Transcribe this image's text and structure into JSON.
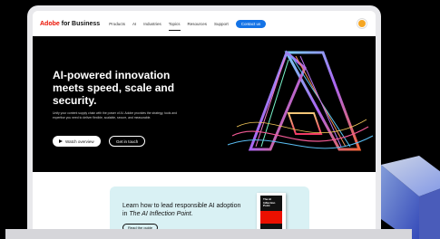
{
  "nav": {
    "brand_adobe": "Adobe",
    "brand_text": "for Business",
    "links": [
      "Products",
      "AI",
      "Industries",
      "Topics",
      "Resources",
      "Support"
    ],
    "active_index": 3,
    "contact_label": "Contact us"
  },
  "hero": {
    "title": "AI-powered innovation meets speed, scale and security.",
    "body": "Unify your content supply chain with the power of AI. Adobe provides the strategy, tools and expertise you need to deliver flexible, scalable, secure, and measurable.",
    "watch_label": "Watch overview",
    "call_label": "Get in touch"
  },
  "promo": {
    "text_prefix": "Learn how to lead responsible AI adoption in ",
    "text_em": "The AI Inflection Point",
    "text_suffix": ".",
    "button_label": "Read the guide",
    "book_title": "The AI Inflection Point"
  },
  "colors": {
    "adobe_red": "#eb1000",
    "accent_blue": "#1473e6",
    "promo_bg": "#d9f1f4"
  }
}
